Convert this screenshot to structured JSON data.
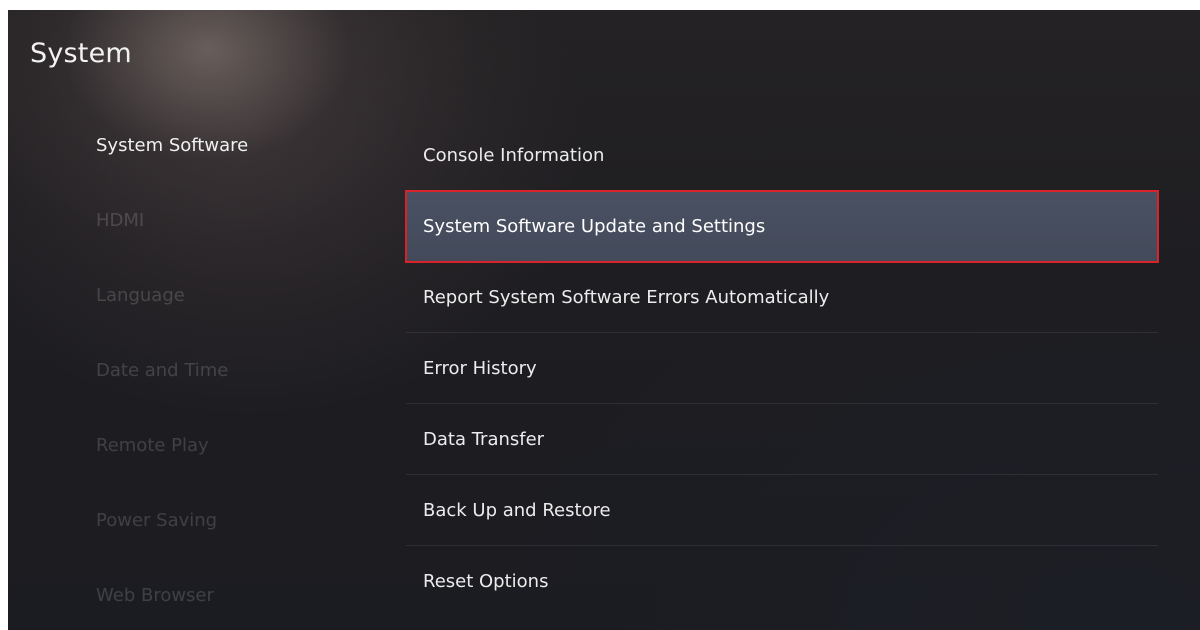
{
  "header": {
    "title": "System"
  },
  "sidebar": {
    "items": [
      {
        "label": "System Software",
        "active": true
      },
      {
        "label": "HDMI",
        "active": false
      },
      {
        "label": "Language",
        "active": false
      },
      {
        "label": "Date and Time",
        "active": false
      },
      {
        "label": "Remote Play",
        "active": false
      },
      {
        "label": "Power Saving",
        "active": false
      },
      {
        "label": "Web Browser",
        "active": false
      }
    ]
  },
  "main": {
    "items": [
      {
        "label": "Console Information",
        "selected": false
      },
      {
        "label": "System Software Update and Settings",
        "selected": true
      },
      {
        "label": "Report System Software Errors Automatically",
        "selected": false
      },
      {
        "label": "Error History",
        "selected": false
      },
      {
        "label": "Data Transfer",
        "selected": false
      },
      {
        "label": "Back Up and Restore",
        "selected": false
      },
      {
        "label": "Reset Options",
        "selected": false
      }
    ]
  },
  "colors": {
    "selection_outline": "#d9232b",
    "selection_fill": "#474e5e",
    "text_primary": "#f0f0f0",
    "text_dim": "rgba(255,255,255,0.16)",
    "background": "#1e1d21"
  }
}
